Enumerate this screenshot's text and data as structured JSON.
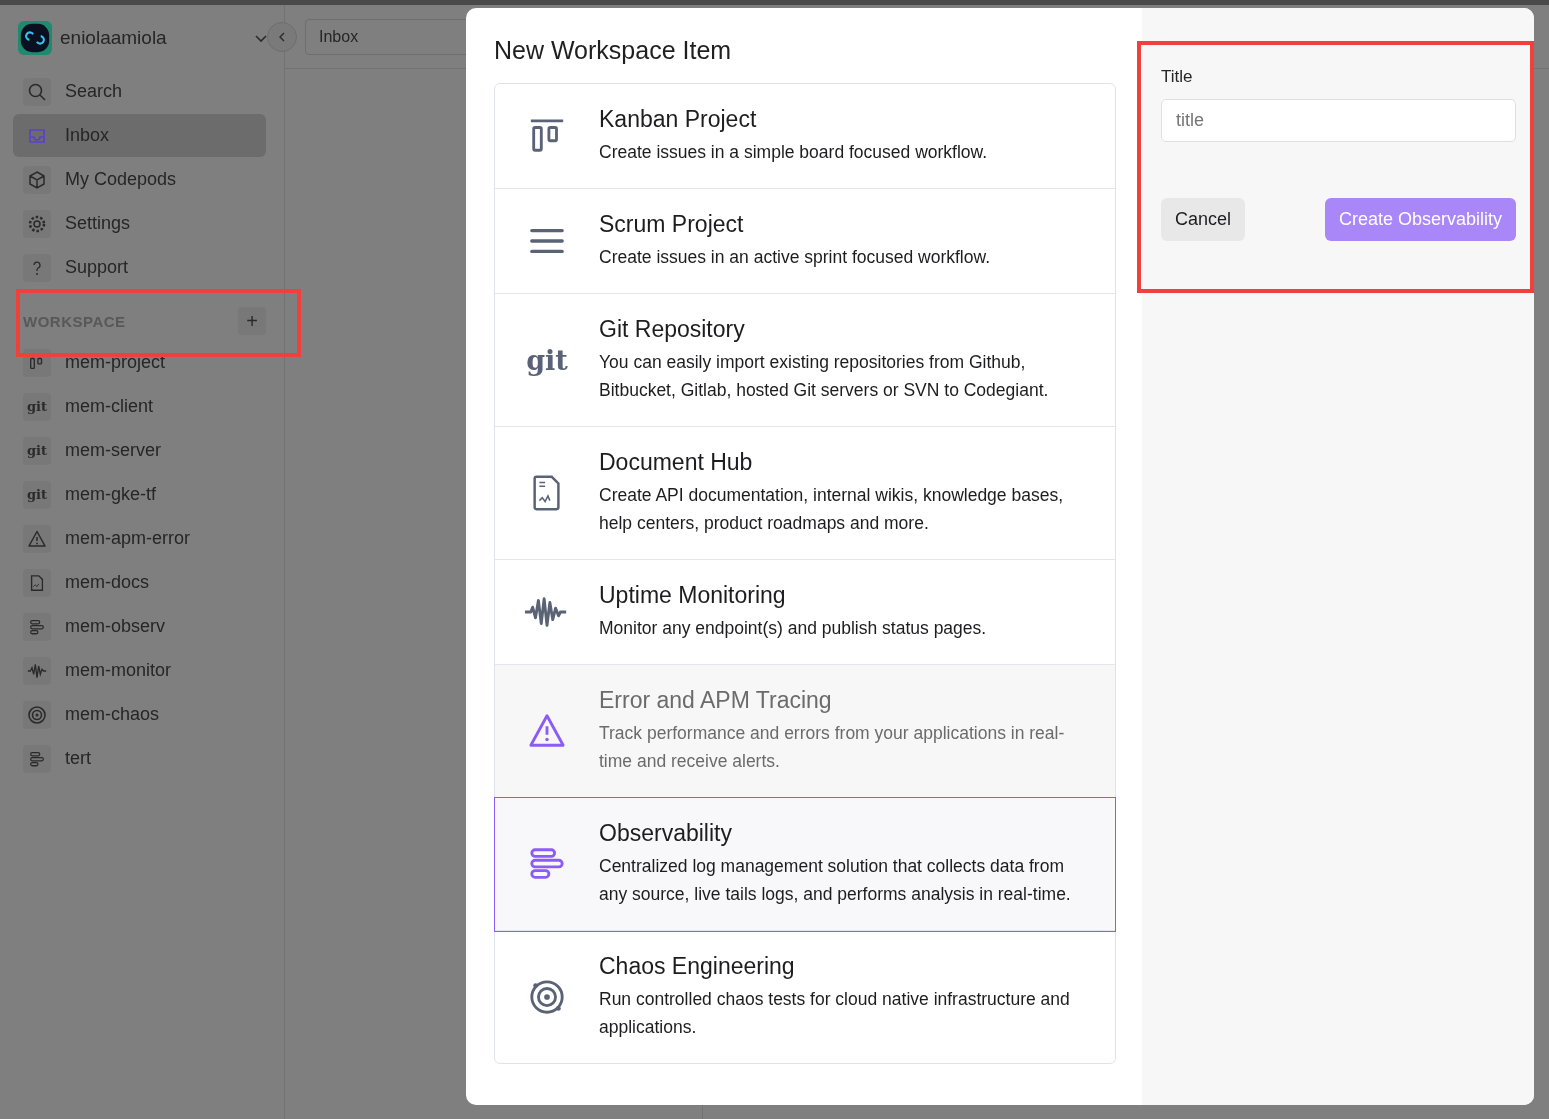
{
  "sidebar": {
    "account": {
      "name": "eniolaamiola"
    },
    "nav": [
      {
        "label": "Search",
        "kind": "search",
        "selected": false
      },
      {
        "label": "Inbox",
        "kind": "inbox",
        "selected": true
      },
      {
        "label": "My Codepods",
        "kind": "box",
        "selected": false
      },
      {
        "label": "Settings",
        "kind": "gear",
        "selected": false
      },
      {
        "label": "Support",
        "kind": "help",
        "selected": false
      }
    ],
    "workspace": {
      "heading": "WORKSPACE",
      "add": "+",
      "highlighted": true,
      "items": [
        {
          "label": "mem-project",
          "kind": "kanban"
        },
        {
          "label": "mem-client",
          "kind": "git",
          "icon_text": "git"
        },
        {
          "label": "mem-server",
          "kind": "git",
          "icon_text": "git"
        },
        {
          "label": "mem-gke-tf",
          "kind": "git",
          "icon_text": "git"
        },
        {
          "label": "mem-apm-error",
          "kind": "warning"
        },
        {
          "label": "mem-docs",
          "kind": "doc"
        },
        {
          "label": "mem-observ",
          "kind": "observ"
        },
        {
          "label": "mem-monitor",
          "kind": "wave"
        },
        {
          "label": "mem-chaos",
          "kind": "target"
        },
        {
          "label": "tert",
          "kind": "observ"
        }
      ]
    }
  },
  "topbar": {
    "page_field": "Inbox"
  },
  "modal": {
    "title": "New Workspace Item",
    "items": [
      {
        "title": "Kanban Project",
        "description": "Create issues in a simple board focused workflow.",
        "kind": "kanban",
        "selected": false,
        "disabled": false
      },
      {
        "title": "Scrum Project",
        "description": "Create issues in an active sprint focused workflow.",
        "kind": "scrum",
        "selected": false,
        "disabled": false
      },
      {
        "title": "Git Repository",
        "description": "You can easily import existing repositories from Github, Bitbucket, Gitlab, hosted Git servers or SVN to Codegiant.",
        "kind": "git",
        "icon_text": "git",
        "selected": false,
        "disabled": false
      },
      {
        "title": "Document Hub",
        "description": "Create API documentation, internal wikis, knowledge bases, help centers, product roadmaps and more.",
        "kind": "doc",
        "selected": false,
        "disabled": false
      },
      {
        "title": "Uptime Monitoring",
        "description": "Monitor any endpoint(s) and publish status pages.",
        "kind": "wave",
        "selected": false,
        "disabled": false
      },
      {
        "title": "Error and APM Tracing",
        "description": "Track performance and errors from your applications in real-time and receive alerts.",
        "kind": "warning",
        "selected": false,
        "disabled": true
      },
      {
        "title": "Observability",
        "description": "Centralized log management solution that collects data from any source, live tails logs, and performs analysis in real-time.",
        "kind": "observ",
        "selected": true,
        "disabled": false
      },
      {
        "title": "Chaos Engineering",
        "description": "Run controlled chaos tests for cloud native infrastructure and applications.",
        "kind": "target",
        "selected": false,
        "disabled": false
      }
    ],
    "form": {
      "highlighted": true,
      "label": "Title",
      "placeholder": "title",
      "cancel": "Cancel",
      "submit": "Create Observability",
      "submit_disabled": true
    }
  }
}
